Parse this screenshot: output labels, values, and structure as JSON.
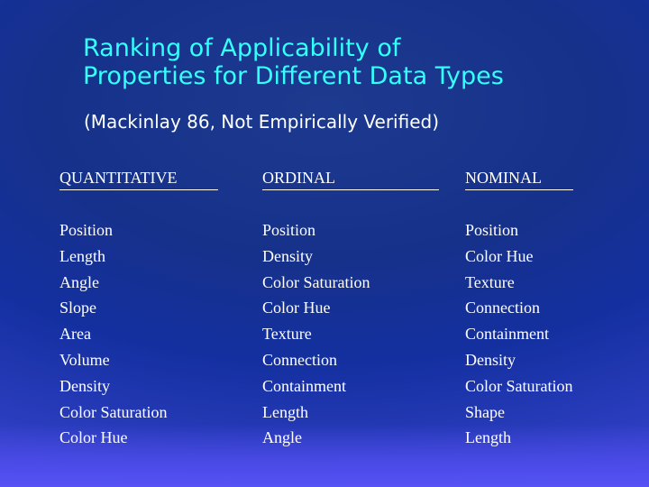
{
  "slide": {
    "title_line1": "Ranking  of Applicability of",
    "title_line2": "Properties for Different Data Types",
    "subtitle": "(Mackinlay 86, Not Empirically Verified)",
    "title_color": "#33ffff",
    "text_color": "#ffffff",
    "background_color": "#1a31a0"
  },
  "table": {
    "columns": [
      {
        "header": "QUANTITATIVE",
        "items": [
          "Position",
          "Length",
          "Angle",
          "Slope",
          "Area",
          "Volume",
          "Density",
          "Color Saturation",
          "Color Hue"
        ]
      },
      {
        "header": "ORDINAL",
        "items": [
          "Position",
          "Density",
          "Color Saturation",
          "Color Hue",
          "Texture",
          "Connection",
          "Containment",
          "Length",
          "Angle"
        ]
      },
      {
        "header": "NOMINAL",
        "items": [
          "Position",
          "Color Hue",
          "Texture",
          "Connection",
          "Containment",
          "Density",
          "Color Saturation",
          "Shape",
          "Length"
        ]
      }
    ]
  }
}
